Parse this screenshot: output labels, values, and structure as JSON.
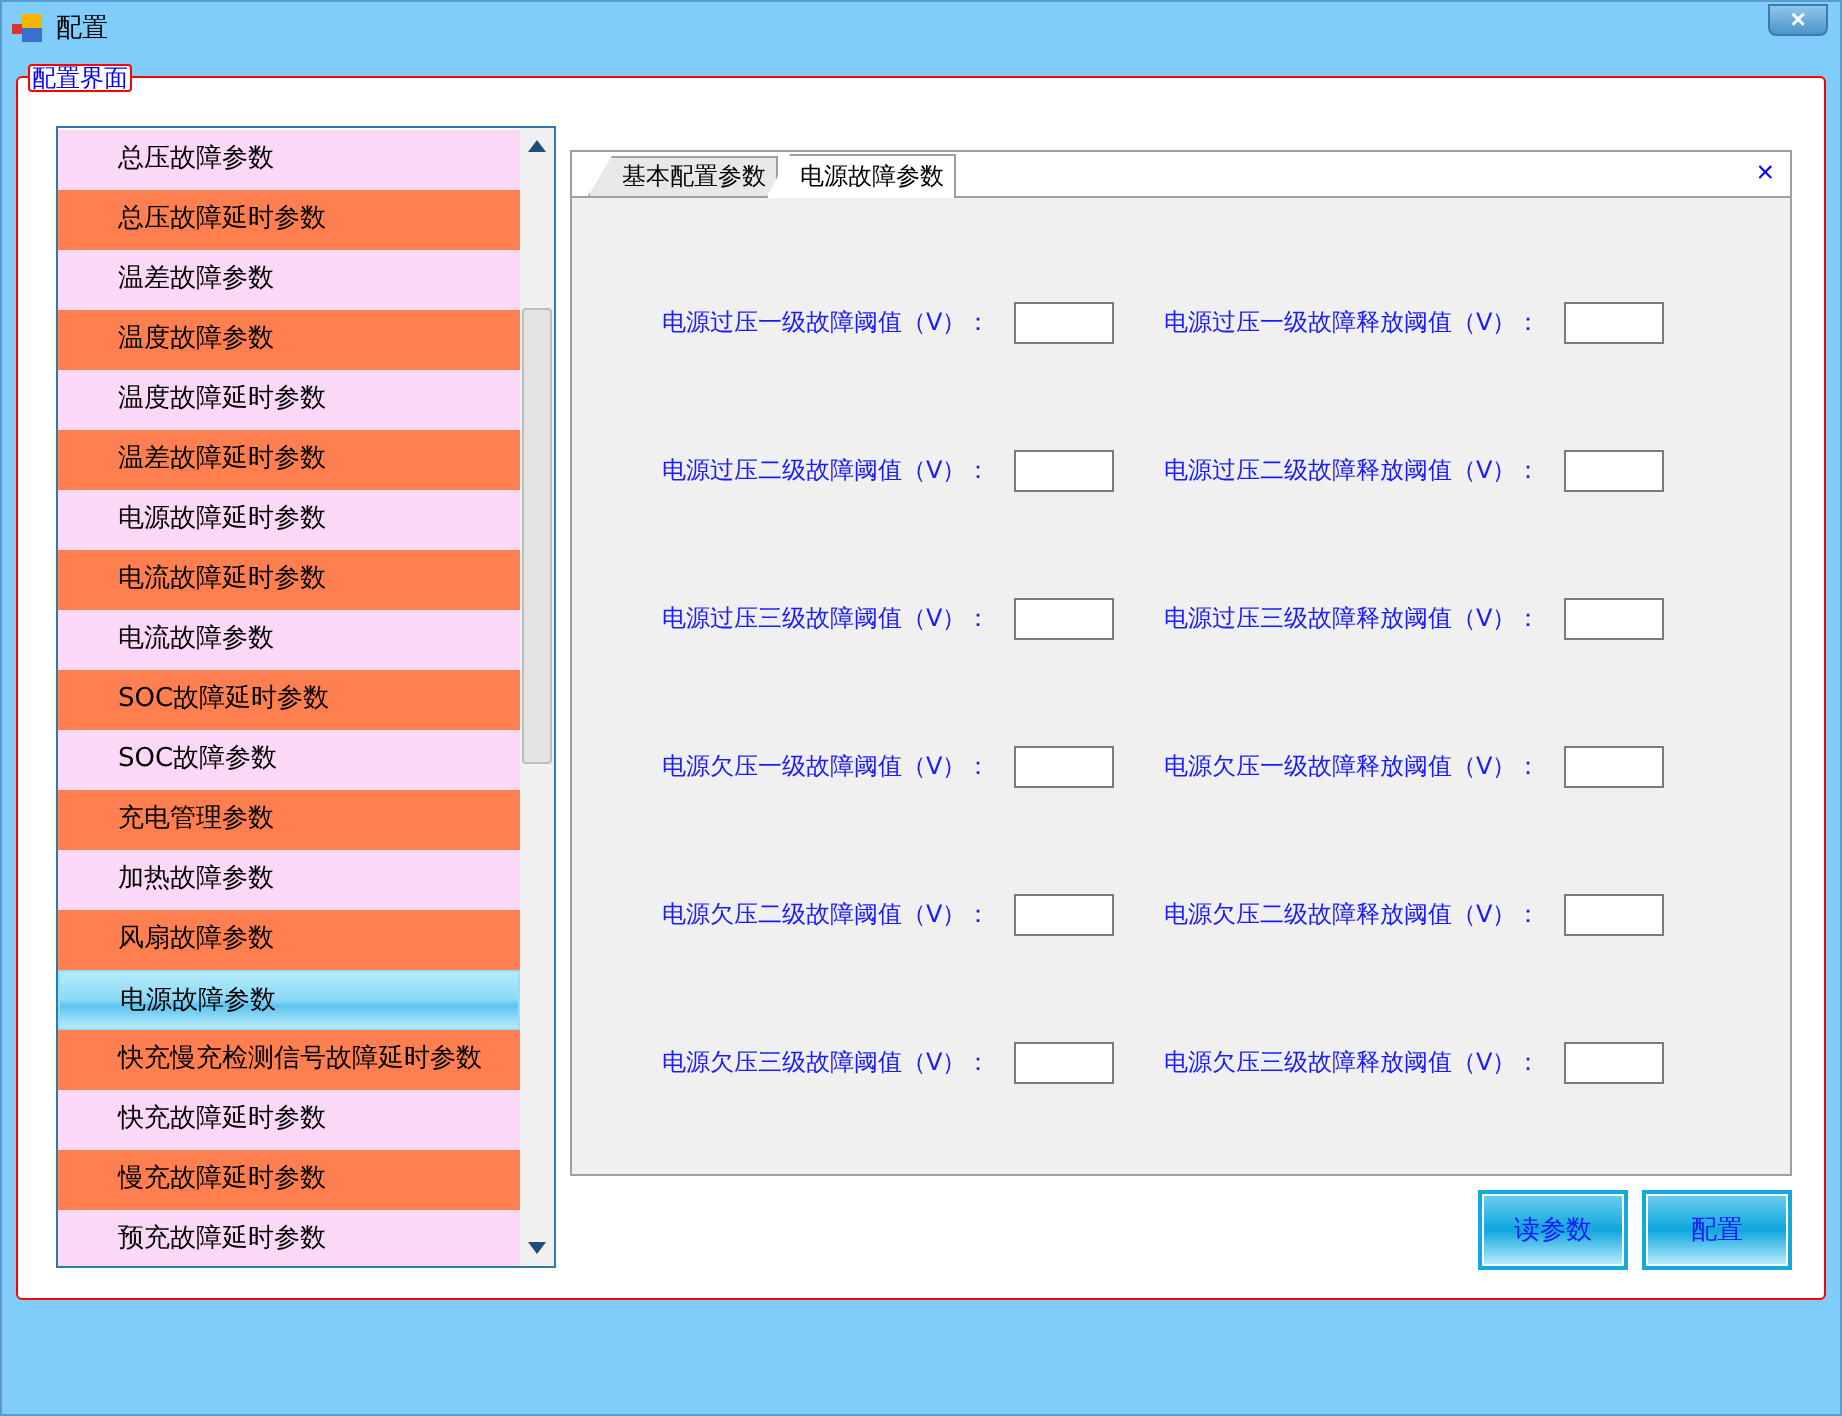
{
  "window": {
    "title": "配置",
    "close": "×"
  },
  "group": {
    "label": "配置界面"
  },
  "list": {
    "items": [
      {
        "label": "总压故障参数",
        "color": "#fbd8f5",
        "selected": false
      },
      {
        "label": "总压故障延时参数",
        "color": "#ff7f50",
        "selected": false
      },
      {
        "label": "温差故障参数",
        "color": "#fbd8f5",
        "selected": false
      },
      {
        "label": "温度故障参数",
        "color": "#ff7f50",
        "selected": false
      },
      {
        "label": "温度故障延时参数",
        "color": "#fbd8f5",
        "selected": false
      },
      {
        "label": "温差故障延时参数",
        "color": "#ff7f50",
        "selected": false
      },
      {
        "label": "电源故障延时参数",
        "color": "#fbd8f5",
        "selected": false
      },
      {
        "label": "电流故障延时参数",
        "color": "#ff7f50",
        "selected": false
      },
      {
        "label": "电流故障参数",
        "color": "#fbd8f5",
        "selected": false
      },
      {
        "label": "SOC故障延时参数",
        "color": "#ff7f50",
        "selected": false
      },
      {
        "label": "SOC故障参数",
        "color": "#fbd8f5",
        "selected": false
      },
      {
        "label": "充电管理参数",
        "color": "#ff7f50",
        "selected": false
      },
      {
        "label": "加热故障参数",
        "color": "#fbd8f5",
        "selected": false
      },
      {
        "label": "风扇故障参数",
        "color": "#ff7f50",
        "selected": false
      },
      {
        "label": "电源故障参数",
        "selected": true
      },
      {
        "label": "快充慢充检测信号故障延时参数",
        "color": "#ff7f50",
        "selected": false
      },
      {
        "label": "快充故障延时参数",
        "color": "#fbd8f5",
        "selected": false
      },
      {
        "label": "慢充故障延时参数",
        "color": "#ff7f50",
        "selected": false
      },
      {
        "label": "预充故障延时参数",
        "color": "#fbd8f5",
        "selected": false
      }
    ]
  },
  "tabs": [
    {
      "label": "基本配置参数",
      "selected": false
    },
    {
      "label": "电源故障参数",
      "selected": true
    }
  ],
  "tab_close": "×",
  "fields": [
    [
      {
        "label": "电源过压一级故障阈值（V）："
      },
      {
        "label": "电源过压一级故障释放阈值（V）："
      }
    ],
    [
      {
        "label": "电源过压二级故障阈值（V）："
      },
      {
        "label": "电源过压二级故障释放阈值（V）："
      }
    ],
    [
      {
        "label": "电源过压三级故障阈值（V）："
      },
      {
        "label": "电源过压三级故障释放阈值（V）："
      }
    ],
    [
      {
        "label": "电源欠压一级故障阈值（V）："
      },
      {
        "label": "电源欠压一级故障释放阈值（V）："
      }
    ],
    [
      {
        "label": "电源欠压二级故障阈值（V）："
      },
      {
        "label": "电源欠压二级故障释放阈值（V）："
      }
    ],
    [
      {
        "label": "电源欠压三级故障阈值（V）："
      },
      {
        "label": "电源欠压三级故障释放阈值（V）："
      }
    ]
  ],
  "buttons": [
    "读参数",
    "配置"
  ]
}
